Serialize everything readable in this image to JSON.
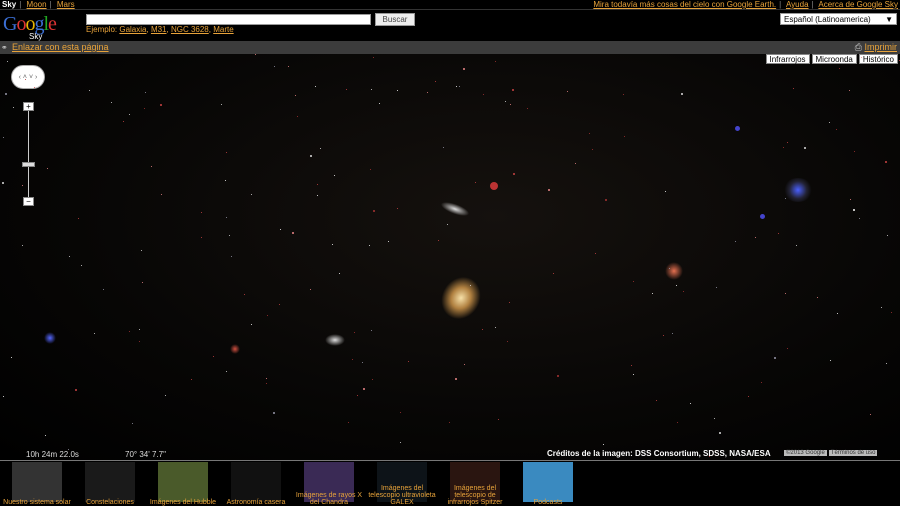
{
  "topbar": {
    "nav": [
      "Sky",
      "Moon",
      "Mars"
    ],
    "right_links": [
      "Mira todavía más cosas del cielo con Google Earth.",
      "Ayuda",
      "Acerca de Google Sky"
    ]
  },
  "header": {
    "logo": "Google",
    "logo_sub": "Sky",
    "search_value": "",
    "search_button": "Buscar",
    "example_label": "Ejemplo:",
    "examples": [
      "Galaxia",
      "M31",
      "NGC 3628",
      "Marte"
    ],
    "language": "Español (Latinoamerica)"
  },
  "linkbar": {
    "link": "Enlazar con esta página",
    "print": "Imprimir"
  },
  "layers": [
    "Infrarrojos",
    "Microonda",
    "Histórico"
  ],
  "coords": {
    "ra": "10h 24m 22.0s",
    "dec": "70° 34' 7.7\""
  },
  "credit": "Créditos de la imagen: DSS Consortium, SDSS, NASA/ESA",
  "copyright": [
    "©2013 Google",
    "Términos de uso"
  ],
  "gallery": [
    {
      "label": "Nuestro sistema solar",
      "color": "#333"
    },
    {
      "label": "Constelaciones",
      "color": "#1a1a1a"
    },
    {
      "label": "Imágenes del Hubble",
      "color": "#4a5a2a"
    },
    {
      "label": "Astronomía casera",
      "color": "#111"
    },
    {
      "label": "Imágenes de rayos X del Chandra",
      "color": "#3a2a55"
    },
    {
      "label": "Imágenes del telescopio ultravioleta GALEX",
      "color": "#0d1318"
    },
    {
      "label": "Imágenes del telescopio de infrarrojos Spitzer",
      "color": "#2a1510"
    },
    {
      "label": "Podcasts",
      "color": "#3a8ac0"
    }
  ]
}
